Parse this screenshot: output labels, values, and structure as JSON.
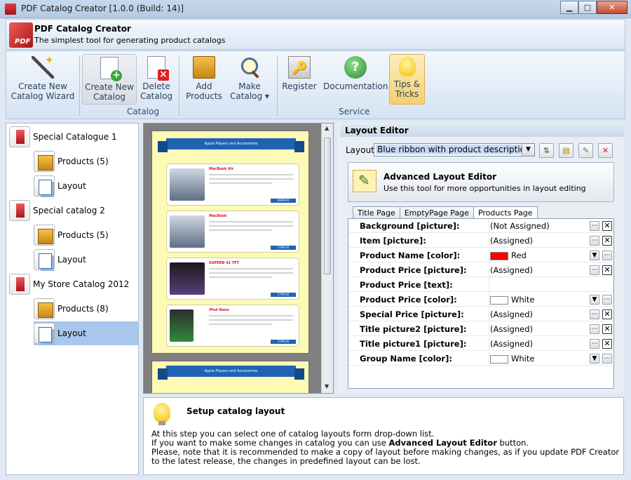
{
  "window": {
    "title": "PDF Catalog Creator [1.0.0 (Build: 14)]",
    "minimize": "▁",
    "maximize": "□",
    "close": "✕"
  },
  "header": {
    "title": "PDF Catalog Creator",
    "subtitle": "The simplest tool for generating product catalogs",
    "logo_text": "PDF"
  },
  "ribbon": {
    "buttons": [
      {
        "label": "Create New\nCatalog Wizard"
      },
      {
        "label": "Create New\nCatalog"
      },
      {
        "label": "Delete\nCatalog"
      },
      {
        "label": "Add\nProducts"
      },
      {
        "label": "Make\nCatalog ▾"
      },
      {
        "label": "Register"
      },
      {
        "label": "Documentation"
      },
      {
        "label": "Tips &\nTricks"
      }
    ],
    "groups": {
      "catalog": "Catalog",
      "service": "Service"
    },
    "help_glyph": "?"
  },
  "tree": [
    {
      "label": "Special Catalogue 1"
    },
    {
      "label": "Products (5)"
    },
    {
      "label": "Layout"
    },
    {
      "label": "Special catalog 2"
    },
    {
      "label": "Products (5)"
    },
    {
      "label": "Layout"
    },
    {
      "label": "My Store Catalog 2012"
    },
    {
      "label": "Products (8)"
    },
    {
      "label": "Layout"
    }
  ],
  "preview": {
    "banner": "Apple Players and Accessories",
    "cards": [
      {
        "name": "MacBook Air",
        "price": "$999.00"
      },
      {
        "name": "MacBook",
        "price": "1799.00"
      },
      {
        "name": "SUPERB 42 TFT",
        "price": "1799.00"
      },
      {
        "name": "iPod Nano",
        "price": "1799.00"
      }
    ]
  },
  "editor": {
    "header": "Layout Editor",
    "layout_label": "Layout",
    "layout_value": "Blue ribbon with product description",
    "advanced": {
      "title": "Advanced Layout Editor",
      "desc": "Use this tool for more opportunities in layout editing"
    },
    "tabs": [
      "Title Page",
      "EmptyPage Page",
      "Products Page"
    ],
    "rows": [
      {
        "key": "Background [picture]:",
        "value": "(Not Assigned)"
      },
      {
        "key": "Item [picture]:",
        "value": "(Assigned)"
      },
      {
        "key": "Product Name [color]:",
        "value": "Red",
        "color": "#ff0000"
      },
      {
        "key": "Product Price [picture]:",
        "value": "(Assigned)"
      },
      {
        "key": "Product Price [text]:",
        "value": ""
      },
      {
        "key": "Product Price [color]:",
        "value": "White",
        "color": "#ffffff"
      },
      {
        "key": "Special Price [picture]:",
        "value": "(Assigned)"
      },
      {
        "key": "Title picture2 [picture]:",
        "value": "(Assigned)"
      },
      {
        "key": "Title picture1 [picture]:",
        "value": "(Assigned)"
      },
      {
        "key": "Group Name [color]:",
        "value": "White",
        "color": "#ffffff"
      }
    ]
  },
  "info": {
    "title": "Setup catalog layout",
    "line1": "At this step you can select one of catalog layouts form drop-down list.",
    "line2a": "If you want to make some changes in catalog you can use ",
    "line2b": "Advanced Layout Editor",
    "line2c": " button.",
    "line3": "Please, note that it is recommended to make a copy of layout before making changes, as if you update PDF Creator to the latest release, the changes in predefined layout can be lost."
  }
}
